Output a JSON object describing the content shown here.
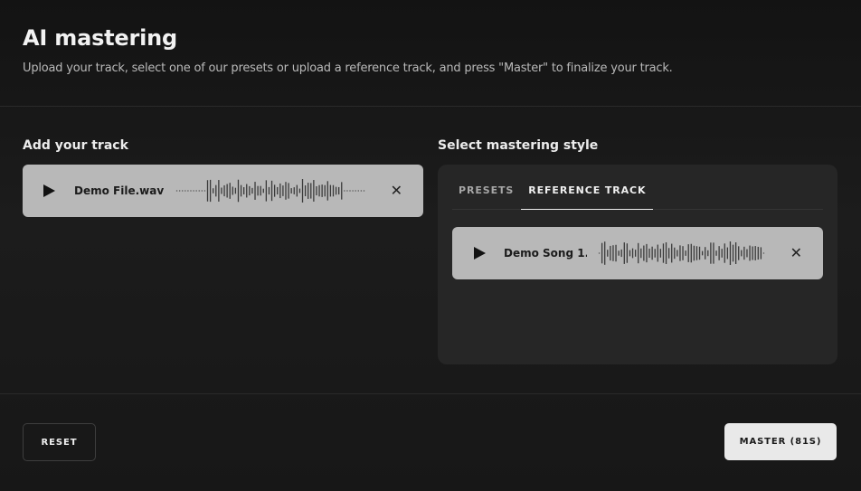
{
  "header": {
    "title": "AI mastering",
    "subtitle": "Upload your track, select one of our presets or upload a reference track, and press \"Master\" to finalize your track."
  },
  "add_track": {
    "label": "Add your track",
    "file_name": "Demo File.wav"
  },
  "mastering_style": {
    "label": "Select mastering style",
    "tabs": [
      {
        "label": "PRESETS",
        "active": false
      },
      {
        "label": "REFERENCE TRACK",
        "active": true
      }
    ],
    "reference_file_name": "Demo Song 1...."
  },
  "buttons": {
    "reset": "RESET",
    "master": "MASTER (81S)"
  },
  "icons": {
    "play": "play-icon",
    "close": "close-icon",
    "waveform": "waveform-icon"
  },
  "colors": {
    "background": "#171717",
    "track_card": "#b8b8b8",
    "panel": "#262626",
    "master_button": "#e9e9e9"
  }
}
